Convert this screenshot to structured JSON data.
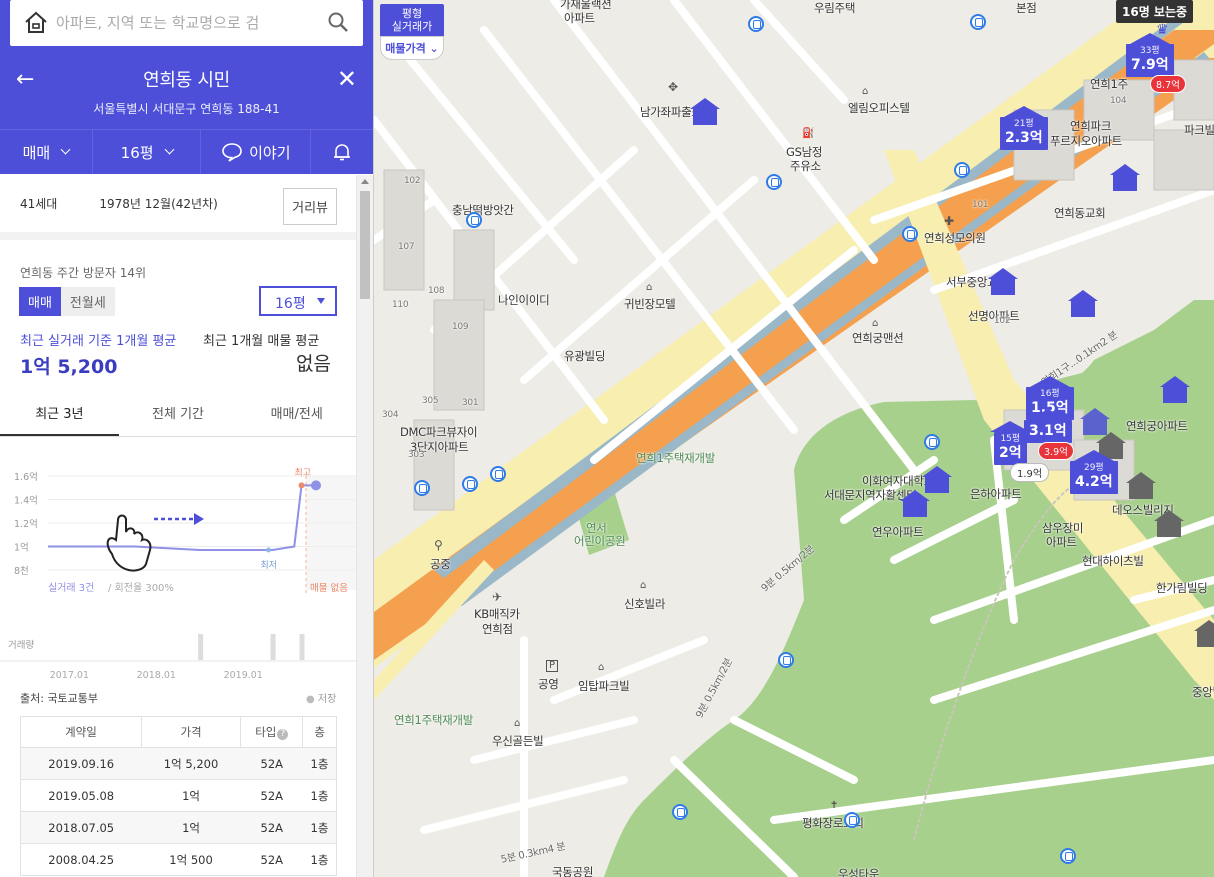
{
  "search": {
    "placeholder": "아파트, 지역 또는 학교명으로 검"
  },
  "header": {
    "title": "연희동 시민",
    "address": "서울특별시 서대문구 연희동 188-41",
    "back_icon": "←",
    "close_icon": "✕"
  },
  "tabs": {
    "deal": "매매",
    "size": "16평",
    "talk": "이야기"
  },
  "info": {
    "households": "41세대",
    "built": "1978년 12월(42년차)",
    "street_view": "거리뷰"
  },
  "visitors": "연희동 주간 방문자 14위",
  "segment": {
    "sale": "매매",
    "rent": "전월세"
  },
  "size_select": "16평",
  "average": {
    "actual_label": "최근 실거래 기준 1개월 평균",
    "listing_label": "최근 1개월 매물 평균",
    "actual_value": "1억 5,200",
    "listing_value": "없음"
  },
  "period_tabs": [
    "최근 3년",
    "전체 기간",
    "매매/전세"
  ],
  "chart_data": {
    "type": "line",
    "yticks": [
      "1.6억",
      "1.4억",
      "1.2억",
      "1억",
      "8천"
    ],
    "ylim": [
      0.8,
      1.6
    ],
    "xticks": [
      "2017.01",
      "2018.01",
      "2019.01"
    ],
    "x": [
      "2016.10",
      "2017.06",
      "2017.10",
      "2018.07",
      "2019.05",
      "2019.08",
      "2019.09",
      "2019.11"
    ],
    "values": [
      1.0,
      1.0,
      1.0,
      0.97,
      0.97,
      1.0,
      1.52,
      1.52
    ],
    "high_label": "최고",
    "low_label": "최저",
    "footer_left": "실거래 3건 / 회전율 300%",
    "footer_right": "매물 없음",
    "volume_label": "거래량",
    "volume_months": [
      "2018.07",
      "2019.05",
      "2019.09"
    ]
  },
  "source": "출처: 국토교통부",
  "save_label": "저장",
  "table": {
    "headers": [
      "계약일",
      "가격",
      "타입",
      "층"
    ],
    "rows": [
      [
        "2019.09.16",
        "1억 5,200",
        "52A",
        "1층"
      ],
      [
        "2019.05.08",
        "1억",
        "52A",
        "1층"
      ],
      [
        "2018.07.05",
        "1억",
        "52A",
        "1층"
      ],
      [
        "2008.04.25",
        "1억 500",
        "52A",
        "1층"
      ]
    ]
  },
  "map": {
    "viewers": "16명 보는중",
    "toggle_top": "평형\n실거래가",
    "toggle_bottom": "매물가격",
    "labels": [
      "가재울랙션\n아파트",
      "우림주택",
      "본점",
      "남가좌파출소",
      "엘림오피스텔",
      "GS남정\n주유소",
      "충남떡방앗간",
      "연희1주",
      "연희파크\n푸르지오아파트",
      "파크빌",
      "연희동교회",
      "연희성모의원",
      "나인이이디",
      "귀빈장모텔",
      "서부중앙교회",
      "선명아파트",
      "유광빌딩",
      "연희궁맨션",
      "DMC파크뷰자이\n3단지아파트",
      "연희1주택재개발",
      "연서\n어린이공원",
      "이화여자대학교\n서대문지역자활센터",
      "은하아파트",
      "연희궁아파트",
      "삼우장미\n아파트",
      "데오스빌리지",
      "연우아파트",
      "현대하이츠빌",
      "한가림빌딩",
      "공중",
      "KB매직카\n연희점",
      "신호빌라",
      "공영",
      "임탑파크빌",
      "중앙빌",
      "연희1주택재개발",
      "우신골든빌",
      "평화장로교회",
      "국동공원",
      "우성타운",
      "104",
      "102",
      "107",
      "110",
      "108",
      "109",
      "305",
      "301",
      "304",
      "303",
      "101",
      "102"
    ],
    "pins": [
      {
        "pyeong": "33평",
        "value": "7.9억",
        "tag": "8.7억"
      },
      {
        "pyeong": "21평",
        "value": "2.3억"
      },
      {
        "pyeong": "16평",
        "value": "1.5억"
      },
      {
        "pyeong": "",
        "value": "3.1억"
      },
      {
        "pyeong": "15평",
        "value": "2억",
        "tag": "3.9억",
        "sub": "1.9억"
      },
      {
        "pyeong": "29평",
        "value": "4.2억"
      }
    ],
    "road_labels": [
      "연희1구...0.1km2 분",
      "9분 0.5km/2분",
      "5분 0.3km4 분",
      "9분 0.5km/2분"
    ]
  },
  "colors": {
    "brand": "#4d4fd8",
    "red_tag": "#e8343b",
    "chart_line": "#8f90e6",
    "high": "#e98a6a"
  }
}
